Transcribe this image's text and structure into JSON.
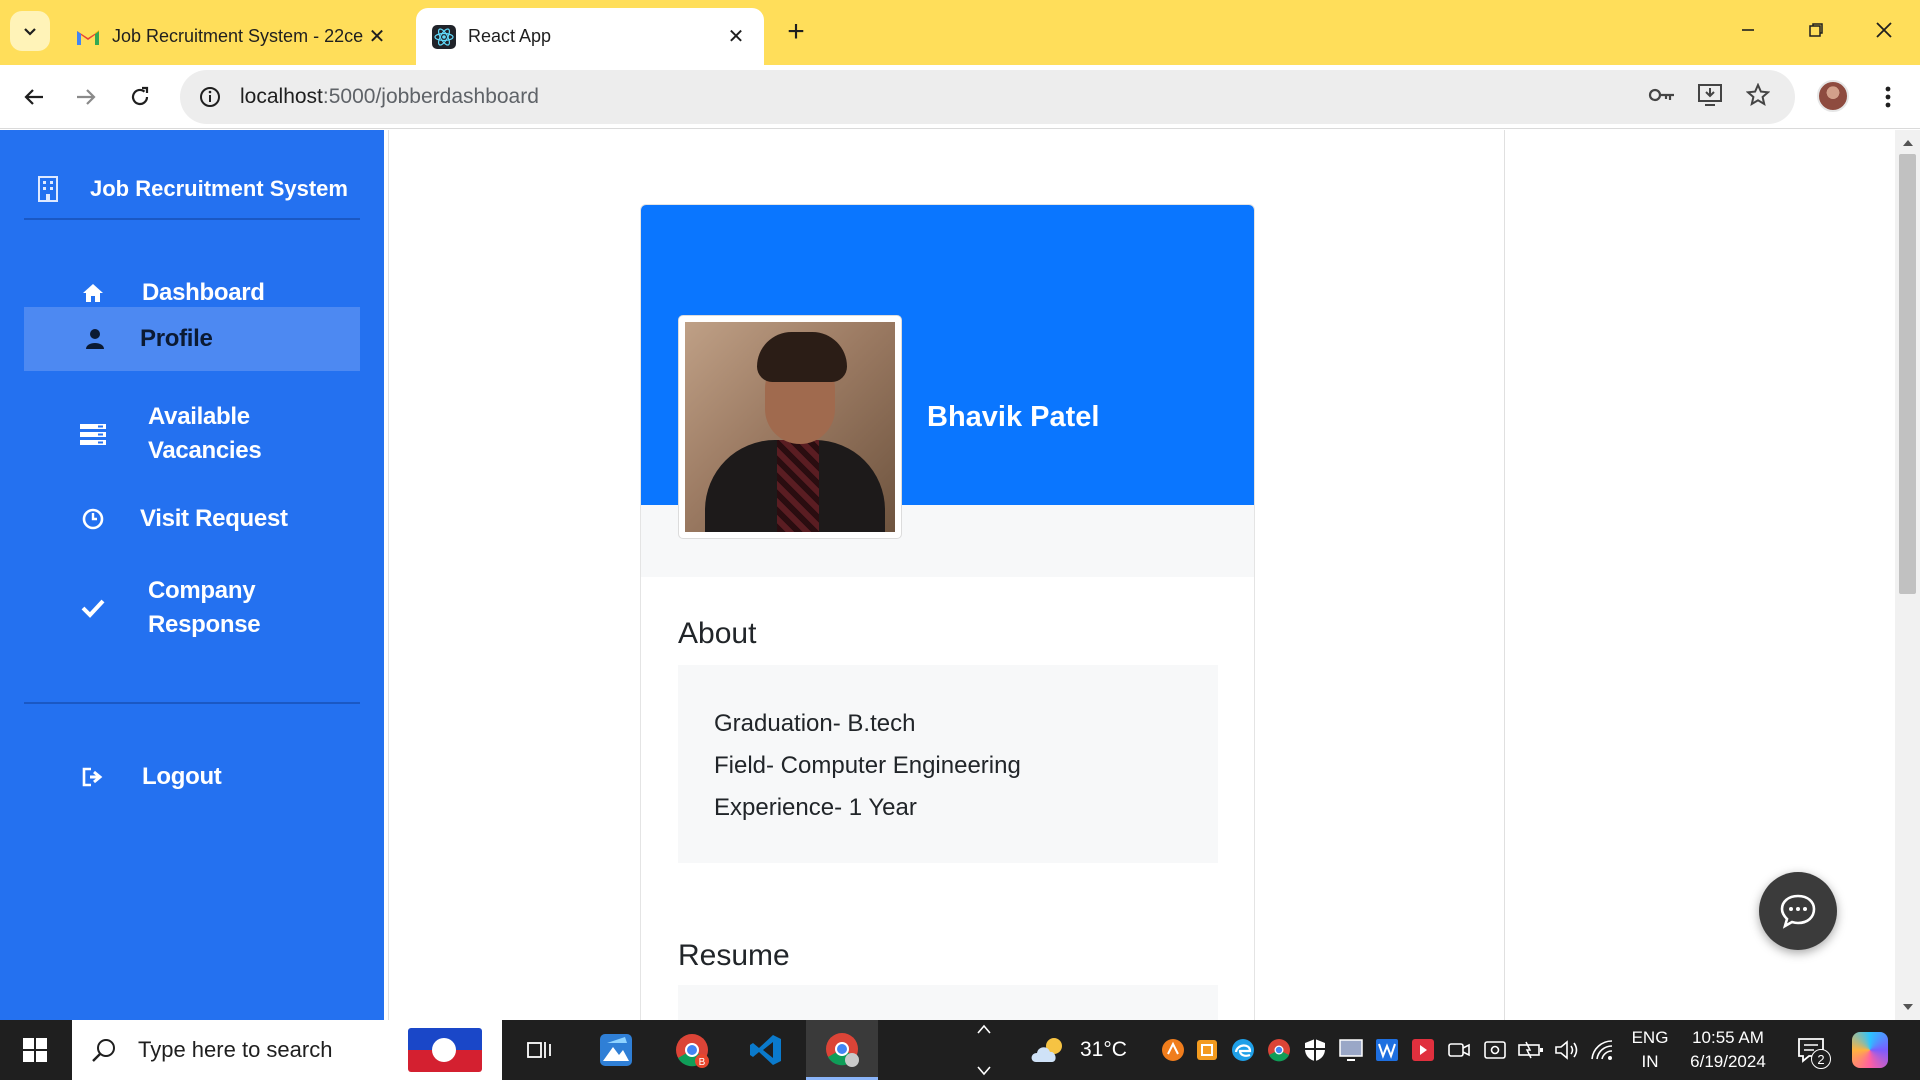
{
  "browser": {
    "tabs": [
      {
        "title": "Job Recruitment System - 22ce",
        "icon": "gmail-icon",
        "active": false
      },
      {
        "title": "React App",
        "icon": "react-icon",
        "active": true
      }
    ],
    "url_host": "localhost",
    "url_path": ":5000/jobberdashboard"
  },
  "sidebar": {
    "brand": "Job Recruitment System",
    "items": [
      {
        "label": "Dashboard",
        "icon": "home-icon",
        "active": false
      },
      {
        "label": "Profile",
        "icon": "user-icon",
        "active": true
      },
      {
        "label": "Available Vacancies",
        "icon": "server-icon",
        "active": false
      },
      {
        "label": "Visit Request",
        "icon": "clock-icon",
        "active": false
      },
      {
        "label": "Company Response",
        "icon": "check-icon",
        "active": false
      }
    ],
    "logout": "Logout"
  },
  "profile": {
    "name": "Bhavik Patel",
    "about_title": "About",
    "about_lines": [
      "Graduation- B.tech",
      "Field- Computer Engineering",
      "Experience- 1 Year"
    ],
    "resume_title": "Resume"
  },
  "taskbar": {
    "search_placeholder": "Type here to search",
    "temperature": "31°C",
    "lang_line1": "ENG",
    "lang_line2": "IN",
    "time": "10:55 AM",
    "date": "6/19/2024",
    "notification_count": "2"
  },
  "colors": {
    "sidebar_bg": "#2471f0",
    "sidebar_active": "#4d89f2",
    "card_header": "#0a76ff",
    "tab_strip": "#ffde5a"
  }
}
